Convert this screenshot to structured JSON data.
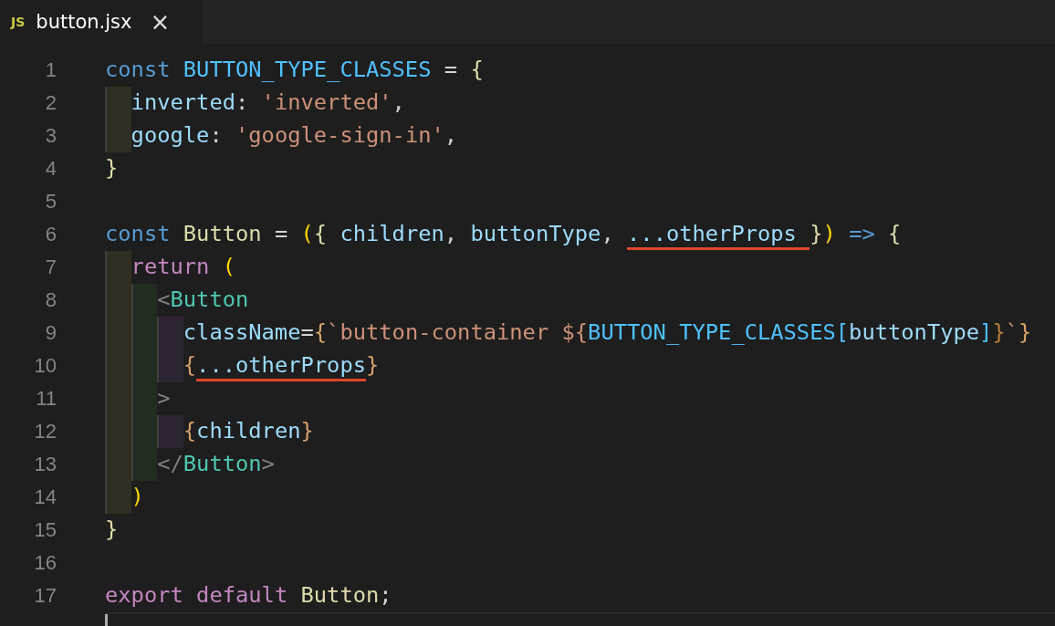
{
  "tab": {
    "icon_text": "JS",
    "title": "button.jsx",
    "close": "×",
    "selected": true
  },
  "lines": [
    {
      "number": "1",
      "tokens": [
        {
          "kind": "kw",
          "text": "const "
        },
        {
          "kind": "const",
          "text": "BUTTON_TYPE_CLASSES"
        },
        {
          "kind": "punct",
          "text": " = "
        },
        {
          "kind": "brace",
          "text": "{"
        }
      ],
      "children": [
        {
          "number": "2",
          "tokens": [
            {
              "kind": "prop",
              "text": "inverted"
            },
            {
              "kind": "punct",
              "text": ": "
            },
            {
              "kind": "str",
              "text": "'inverted'"
            },
            {
              "kind": "punct",
              "text": ","
            }
          ]
        },
        {
          "number": "3",
          "tokens": [
            {
              "kind": "prop",
              "text": "google"
            },
            {
              "kind": "punct",
              "text": ": "
            },
            {
              "kind": "str",
              "text": "'google-sign-in'"
            },
            {
              "kind": "punct",
              "text": ","
            }
          ]
        }
      ]
    },
    {
      "number": "4",
      "tokens": [
        {
          "kind": "brace",
          "text": "}"
        }
      ]
    },
    {
      "number": "5"
    },
    {
      "number": "6",
      "tokens": [
        {
          "kind": "kw",
          "text": "const "
        },
        {
          "kind": "fn",
          "text": "Button"
        },
        {
          "kind": "punct",
          "text": " = "
        },
        {
          "kind": "paren",
          "text": "("
        },
        {
          "kind": "brace",
          "text": "{ "
        },
        {
          "kind": "prop",
          "text": "children"
        },
        {
          "kind": "punct",
          "text": ", "
        },
        {
          "kind": "prop",
          "text": "buttonType"
        },
        {
          "kind": "punct",
          "text": ", "
        },
        {
          "kind": "prop",
          "text": "...otherProps ",
          "underlined": true
        },
        {
          "kind": "brace",
          "text": "}"
        },
        {
          "kind": "paren",
          "text": ")"
        },
        {
          "kind": "kw",
          "text": " => "
        },
        {
          "kind": "brace",
          "text": "{"
        }
      ],
      "children": [
        {
          "number": "7",
          "tokens": [
            {
              "kind": "ctrl",
              "text": "return "
            },
            {
              "kind": "paren",
              "text": "("
            }
          ],
          "children": [
            {
              "number": "8",
              "tokens": [
                {
                  "kind": "angle",
                  "text": "<"
                },
                {
                  "kind": "tag",
                  "text": "Button"
                }
              ],
              "children": [
                {
                  "number": "9",
                  "tokens": [
                    {
                      "kind": "prop",
                      "text": "className"
                    },
                    {
                      "kind": "punct",
                      "text": "="
                    },
                    {
                      "kind": "jsx",
                      "text": "{"
                    },
                    {
                      "kind": "str",
                      "text": "`button-container ${"
                    },
                    {
                      "kind": "const",
                      "text": "BUTTON_TYPE_CLASSES"
                    },
                    {
                      "kind": "const",
                      "text": "["
                    },
                    {
                      "kind": "prop",
                      "text": "buttonType"
                    },
                    {
                      "kind": "const",
                      "text": "]"
                    },
                    {
                      "kind": "tmpl",
                      "text": "}"
                    },
                    {
                      "kind": "str",
                      "text": "`"
                    },
                    {
                      "kind": "jsx",
                      "text": "}"
                    }
                  ]
                },
                {
                  "number": "10",
                  "tokens": [
                    {
                      "kind": "jsx",
                      "text": "{"
                    },
                    {
                      "kind": "prop",
                      "text": "...otherProps",
                      "underlined": true
                    },
                    {
                      "kind": "jsx",
                      "text": "}"
                    }
                  ]
                }
              ]
            },
            {
              "number": "11",
              "tokens": [
                {
                  "kind": "angle",
                  "text": ">"
                }
              ],
              "children": [
                {
                  "number": "12",
                  "tokens": [
                    {
                      "kind": "jsx",
                      "text": "{"
                    },
                    {
                      "kind": "prop",
                      "text": "children"
                    },
                    {
                      "kind": "jsx",
                      "text": "}"
                    }
                  ]
                }
              ]
            },
            {
              "number": "13",
              "tokens": [
                {
                  "kind": "angle",
                  "text": "</"
                },
                {
                  "kind": "tag",
                  "text": "Button"
                },
                {
                  "kind": "angle",
                  "text": ">"
                }
              ]
            }
          ]
        },
        {
          "number": "14",
          "tokens": [
            {
              "kind": "paren",
              "text": ")"
            }
          ]
        }
      ]
    },
    {
      "number": "15",
      "tokens": [
        {
          "kind": "brace",
          "text": "}"
        }
      ]
    },
    {
      "number": "16"
    },
    {
      "number": "17",
      "tokens": [
        {
          "kind": "ctrl",
          "text": "export default "
        },
        {
          "kind": "fn",
          "text": "Button"
        },
        {
          "kind": "punct",
          "text": ";"
        }
      ]
    },
    {
      "cursor": true
    }
  ]
}
